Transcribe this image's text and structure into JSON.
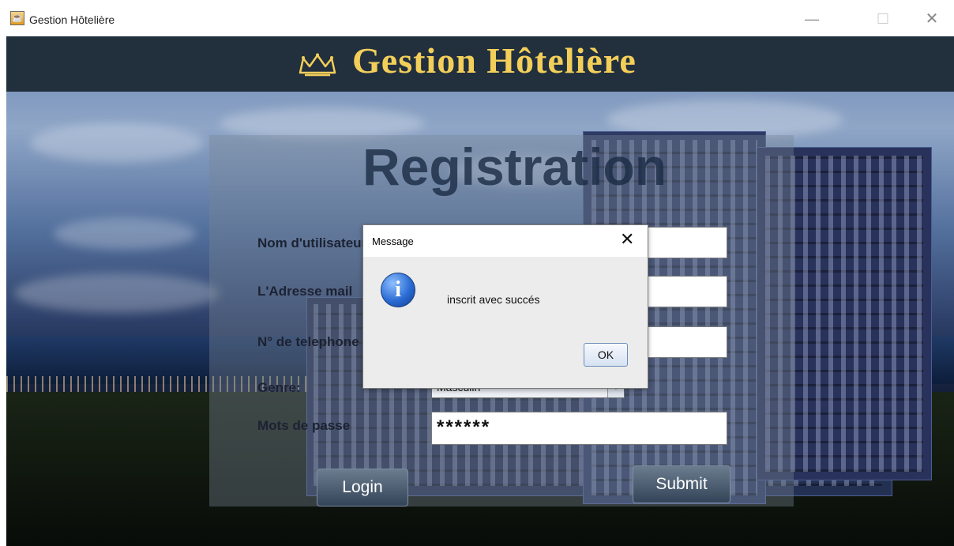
{
  "window": {
    "title": "Gestion Hôtelière",
    "controls": {
      "minimize": "—",
      "maximize": "☐",
      "close": "✕"
    }
  },
  "app": {
    "heading": "Gestion Hôtelière",
    "accent_color": "#f3cf5a",
    "header_color": "#22303e"
  },
  "form": {
    "title": "Registration",
    "fields": {
      "username_label": "Nom d'utilisateur",
      "email_label": "L'Adresse mail",
      "phone_label": "N° de telephone",
      "gender_label": "Genre:",
      "password_label": "Mots de passe"
    },
    "gender_selected": "Masculin",
    "password_value": "******",
    "buttons": {
      "login": "Login",
      "submit": "Submit"
    }
  },
  "dialog": {
    "title": "Message",
    "close": "✕",
    "icon": "info-icon",
    "icon_glyph": "i",
    "message": "inscrit avec succés",
    "ok": "OK"
  }
}
